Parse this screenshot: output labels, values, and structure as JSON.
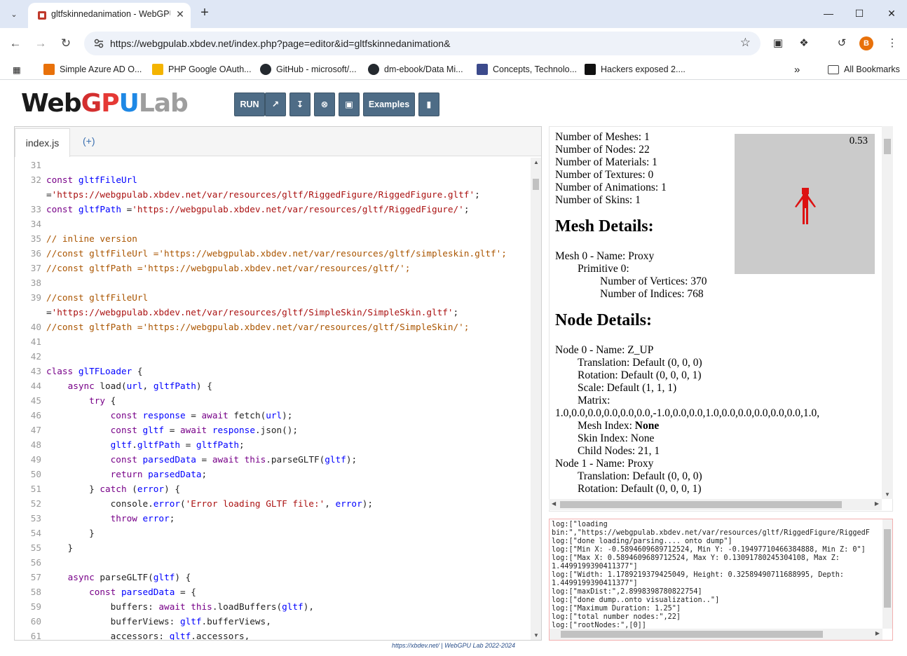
{
  "browser": {
    "tab_title": "gltfskinnedanimation - WebGPU",
    "url": "https://webgpulab.xbdev.net/index.php?page=editor&id=gltfskinnedanimation&",
    "profile_initial": "B",
    "bookmarks": [
      {
        "label": "Simple Azure AD O...",
        "color": "#e8710a"
      },
      {
        "label": "PHP Google OAuth...",
        "color": "#f4b400"
      },
      {
        "label": "GitHub - microsoft/...",
        "color": "#24292f"
      },
      {
        "label": "dm-ebook/Data Mi...",
        "color": "#24292f"
      },
      {
        "label": "Concepts, Technolo...",
        "color": "#3c4a8c"
      },
      {
        "label": "Hackers exposed 2....",
        "color": "#111111"
      }
    ],
    "all_bookmarks": "All Bookmarks"
  },
  "toolbar": {
    "run": "RUN",
    "examples": "Examples",
    "icons": [
      "external-icon",
      "download-icon",
      "stop-icon",
      "save-icon",
      "bookmark-icon"
    ]
  },
  "editor": {
    "active_tab": "index.js",
    "add_tab": "(+)",
    "lines": [
      {
        "n": "31",
        "t": ""
      },
      {
        "n": "32",
        "t": "const gltfFileUrl"
      },
      {
        "n": "",
        "t": "='https://webgpulab.xbdev.net/var/resources/gltf/RiggedFigure/RiggedFigure.gltf';"
      },
      {
        "n": "33",
        "t": "const gltfPath ='https://webgpulab.xbdev.net/var/resources/gltf/RiggedFigure/';"
      },
      {
        "n": "34",
        "t": ""
      },
      {
        "n": "35",
        "t": "// inline version"
      },
      {
        "n": "36",
        "t": "//const gltfFileUrl ='https://webgpulab.xbdev.net/var/resources/gltf/simpleskin.gltf';"
      },
      {
        "n": "37",
        "t": "//const gltfPath ='https://webgpulab.xbdev.net/var/resources/gltf/';"
      },
      {
        "n": "38",
        "t": ""
      },
      {
        "n": "39",
        "t": "//const gltfFileUrl"
      },
      {
        "n": "",
        "t": "='https://webgpulab.xbdev.net/var/resources/gltf/SimpleSkin/SimpleSkin.gltf';"
      },
      {
        "n": "40",
        "t": "//const gltfPath ='https://webgpulab.xbdev.net/var/resources/gltf/SimpleSkin/';"
      },
      {
        "n": "41",
        "t": ""
      },
      {
        "n": "42",
        "t": ""
      },
      {
        "n": "43",
        "t": "class glTFLoader {"
      },
      {
        "n": "44",
        "t": "    async load(url, gltfPath) {"
      },
      {
        "n": "45",
        "t": "        try {"
      },
      {
        "n": "46",
        "t": "            const response = await fetch(url);"
      },
      {
        "n": "47",
        "t": "            const gltf = await response.json();"
      },
      {
        "n": "48",
        "t": "            gltf.gltfPath = gltfPath;"
      },
      {
        "n": "49",
        "t": "            const parsedData = await this.parseGLTF(gltf);"
      },
      {
        "n": "50",
        "t": "            return parsedData;"
      },
      {
        "n": "51",
        "t": "        } catch (error) {"
      },
      {
        "n": "52",
        "t": "            console.error('Error loading GLTF file:', error);"
      },
      {
        "n": "53",
        "t": "            throw error;"
      },
      {
        "n": "54",
        "t": "        }"
      },
      {
        "n": "55",
        "t": "    }"
      },
      {
        "n": "56",
        "t": ""
      },
      {
        "n": "57",
        "t": "    async parseGLTF(gltf) {"
      },
      {
        "n": "58",
        "t": "        const parsedData = {"
      },
      {
        "n": "59",
        "t": "            buffers: await this.loadBuffers(gltf),"
      },
      {
        "n": "60",
        "t": "            bufferViews: gltf.bufferViews,"
      },
      {
        "n": "61",
        "t": "            accessors: gltf.accessors,"
      }
    ]
  },
  "preview": {
    "fps": "0.53",
    "summary": [
      "Number of Meshes: 1",
      "Number of Nodes: 22",
      "Number of Materials: 1",
      "Number of Textures: 0",
      "Number of Animations: 1",
      "Number of Skins: 1"
    ],
    "mesh_heading": "Mesh Details:",
    "mesh": [
      {
        "t": "Mesh 0 - Name: Proxy",
        "i": 0
      },
      {
        "t": "Primitive 0:",
        "i": 1
      },
      {
        "t": "Number of Vertices: 370",
        "i": 2
      },
      {
        "t": "Number of Indices: 768",
        "i": 2
      }
    ],
    "node_heading": "Node Details:",
    "nodes": [
      {
        "t": "Node 0 - Name: Z_UP",
        "i": 0
      },
      {
        "t": "Translation: Default (0, 0, 0)",
        "i": 1
      },
      {
        "t": "Rotation: Default (0, 0, 0, 1)",
        "i": 1
      },
      {
        "t": "Scale: Default (1, 1, 1)",
        "i": 1
      },
      {
        "t": "Matrix:",
        "i": 1
      },
      {
        "t": "1.0,0.0,0.0,0.0,0.0,0.0,-1.0,0.0,0.0,1.0,0.0,0.0,0.0,0.0,0.0,1.0,",
        "i": 0
      },
      {
        "t": "Mesh Index: ",
        "b": "None",
        "i": 1
      },
      {
        "t": "Skin Index: None",
        "i": 1
      },
      {
        "t": "Child Nodes: 21, 1",
        "i": 1
      },
      {
        "t": "Node 1 - Name: Proxy",
        "i": 0
      },
      {
        "t": "Translation: Default (0, 0, 0)",
        "i": 1
      },
      {
        "t": "Rotation: Default (0, 0, 0, 1)",
        "i": 1
      }
    ]
  },
  "console": {
    "lines": [
      "log:[\"loading",
      "bin:\",\"https://webgpulab.xbdev.net/var/resources/gltf/RiggedFigure/RiggedF",
      "log:[\"done loading/parsing.... onto dump\"]",
      "log:[\"Min X: -0.5894609689712524, Min Y: -0.19497710466384888, Min Z: 0\"]",
      "log:[\"Max X: 0.5894609689712524, Max Y: 0.13091780245304108, Max Z:",
      "1.4499199390411377\"]",
      "log:[\"Width: 1.1789219379425049, Height: 0.32589490711688995, Depth:",
      "1.4499199390411377\"]",
      "log:[\"maxDist:\",2.8998398780822754]",
      "log:[\"done dump..onto visualization..\"]",
      "log:[\"Maximum Duration: 1.25\"]",
      "log:[\"total number nodes:\",22]",
      "log:[\"rootNodes:\",[0]]"
    ]
  },
  "footer": "https://xbdev.net/ | WebGPU Lab 2022-2024"
}
